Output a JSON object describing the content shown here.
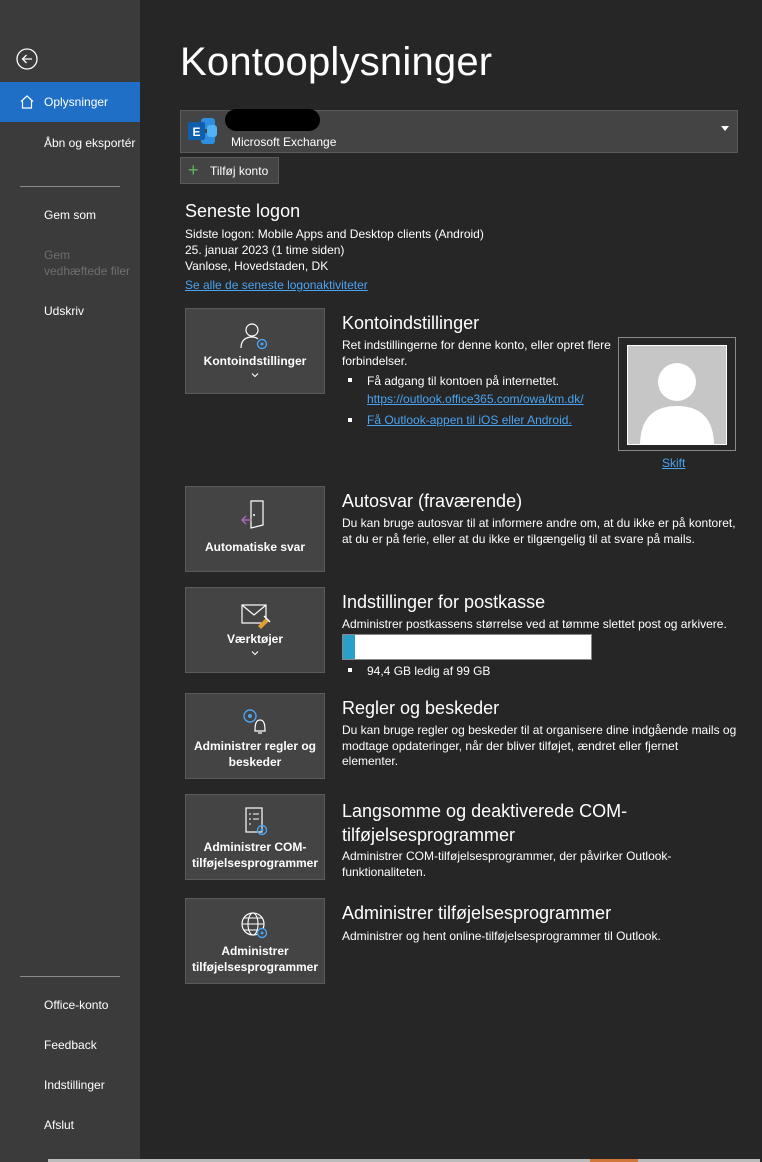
{
  "sidebar": {
    "active": "Oplysninger",
    "items": [
      {
        "label": "Åbn og eksportér"
      },
      {
        "label": "Gem som"
      },
      {
        "label": "Gem vedhæftede filer",
        "disabled": true
      },
      {
        "label": "Udskriv"
      }
    ],
    "bottom_items": [
      {
        "label": "Office-konto"
      },
      {
        "label": "Feedback"
      },
      {
        "label": "Indstillinger"
      },
      {
        "label": "Afslut"
      }
    ]
  },
  "page": {
    "title": "Kontooplysninger"
  },
  "account": {
    "type": "Microsoft Exchange",
    "icon": "exchange-icon",
    "add_label": "Tilføj konto"
  },
  "last_logon": {
    "heading": "Seneste logon",
    "line1": "Sidste logon: Mobile Apps and Desktop clients (Android)",
    "line2": "25. januar 2023 (1 time siden)",
    "line3": "Vanlose, Hovedstaden, DK",
    "link": "Se alle de seneste logonaktiviteter"
  },
  "account_settings": {
    "tile_label": "Kontoindstillinger",
    "heading": "Kontoindstillinger",
    "desc": "Ret indstillingerne for denne konto, eller opret flere forbindelser.",
    "bullet1": "Få adgang til kontoen på internettet.",
    "bullet1_link": "https://outlook.office365.com/owa/km.dk/",
    "bullet2_link": "Få Outlook-appen til iOS eller Android.",
    "photo_change": "Skift"
  },
  "auto_reply": {
    "tile_label": "Automatiske svar",
    "heading": "Autosvar (fraværende)",
    "desc": "Du kan bruge autosvar til at informere andre om, at du ikke er på kontoret, at du er på ferie, eller at du ikke er tilgængelig til at svare på mails."
  },
  "mailbox": {
    "tile_label": "Værktøjer",
    "heading": "Indstillinger for postkasse",
    "desc": "Administrer postkassens størrelse ved at tømme slettet post og arkivere.",
    "usage_fraction": 0.048,
    "usage_text": "94,4 GB ledig af 99 GB"
  },
  "rules": {
    "tile_label": "Administrer regler og beskeder",
    "heading": "Regler og beskeder",
    "desc": "Du kan bruge regler og beskeder til at organisere dine indgående mails og modtage opdateringer, når der bliver tilføjet, ændret eller fjernet elementer."
  },
  "com_addins": {
    "tile_label": "Administrer COM-tilføjelsesprogrammer",
    "heading": "Langsomme og deaktiverede COM-tilføjelsesprogrammer",
    "desc": "Administrer COM-tilføjelsesprogrammer, der påvirker Outlook-funktionaliteten."
  },
  "addins": {
    "tile_label": "Administrer tilføjelsesprogrammer",
    "heading": "Administrer tilføjelsesprogrammer",
    "desc": "Administrer og hent online-tilføjelsesprogrammer til Outlook."
  },
  "colors": {
    "accent": "#1f6fc6",
    "link": "#4aa3f0",
    "progress_fill": "#2aa0c8"
  }
}
